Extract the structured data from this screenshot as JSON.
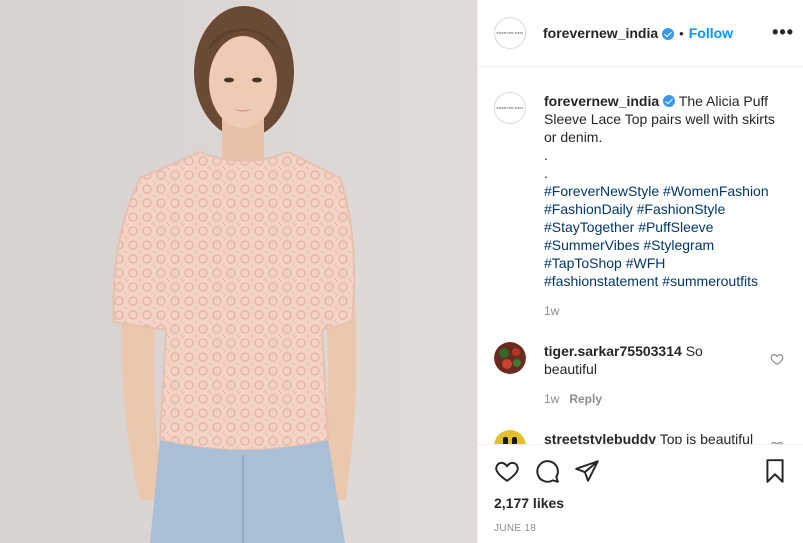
{
  "post": {
    "username": "forevernew_india",
    "follow_label": "Follow",
    "separator": "•",
    "more_label": "•••",
    "avatar_logo_text": "FOREVER NEW"
  },
  "caption": {
    "username": "forevernew_india",
    "text": "The Alicia Puff Sleeve Lace Top pairs well with skirts or denim.",
    "dots": [
      ".",
      "."
    ],
    "hashtags": [
      "#ForeverNewStyle",
      "#WomenFashion",
      "#FashionDaily",
      "#FashionStyle",
      "#StayTogether",
      "#PuffSleeve",
      "#SummerVibes",
      "#Stylegram",
      "#TapToShop",
      "#WFH",
      "#fashionstatement",
      "#summeroutfits"
    ],
    "time": "1w"
  },
  "comments": [
    {
      "username": "tiger.sarkar75503314",
      "text": "So beautiful",
      "time": "1w",
      "reply_label": "Reply",
      "emoji": ""
    },
    {
      "username": "streetstylebuddy",
      "text": "Top is beautiful",
      "time": "",
      "reply_label": "",
      "emoji": "💞"
    }
  ],
  "footer": {
    "likes": "2,177 likes",
    "date": "JUNE 18"
  },
  "colors": {
    "link": "#0095f6",
    "hashtag": "#00376b",
    "muted": "#8e8e8e",
    "verified": "#3897f0"
  },
  "icons": {
    "verified": "verified-badge-icon",
    "like": "heart-icon",
    "comment": "comment-bubble-icon",
    "share": "paper-plane-icon",
    "save": "bookmark-icon",
    "more": "ellipsis-icon"
  }
}
